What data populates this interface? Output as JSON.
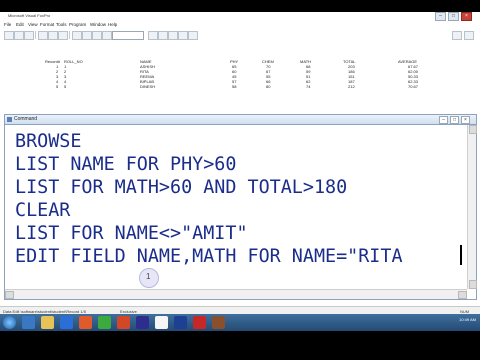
{
  "app": {
    "title": "Microsoft Visual FoxPro"
  },
  "menu": [
    "File",
    "Edit",
    "View",
    "Format",
    "Tools",
    "Program",
    "Window",
    "Help"
  ],
  "table": {
    "headers": [
      "Record#",
      "ROLL_NO",
      "NAME",
      "PHY",
      "CHEM",
      "MATH",
      "TOTAL",
      "AVERAGE"
    ],
    "rows": [
      [
        "1",
        "1",
        "ASHISH",
        "65",
        "70",
        "68",
        "203",
        "67.67"
      ],
      [
        "2",
        "2",
        "RITA",
        "60",
        "67",
        "59",
        "186",
        "62.00"
      ],
      [
        "3",
        "3",
        "REEMA",
        "45",
        "55",
        "51",
        "151",
        "50.33"
      ],
      [
        "4",
        "4",
        "BIPLAB",
        "57",
        "66",
        "62",
        "187",
        "62.33"
      ],
      [
        "5",
        "5",
        "DINESH",
        "58",
        "80",
        "74",
        "212",
        "70.67"
      ]
    ]
  },
  "command_window": {
    "title": "Command",
    "lines": [
      "BROWSE",
      "LIST NAME FOR PHY>60",
      "LIST FOR MATH>60 AND TOTAL>180",
      "CLEAR",
      "LIST FOR NAME<>\"AMIT\"",
      "EDIT FIELD NAME,MATH FOR NAME=\"RITA"
    ]
  },
  "click_marker": "1",
  "status": {
    "left": "Data Edit  \\software\\student\\student\\Record 1/5",
    "mid": "Exclusive",
    "right": "NUM"
  },
  "taskbar": {
    "clock": "10:49 AM"
  },
  "colors": {
    "code_text": "#1b2d8a",
    "taskbar": "#2f5c8a"
  }
}
